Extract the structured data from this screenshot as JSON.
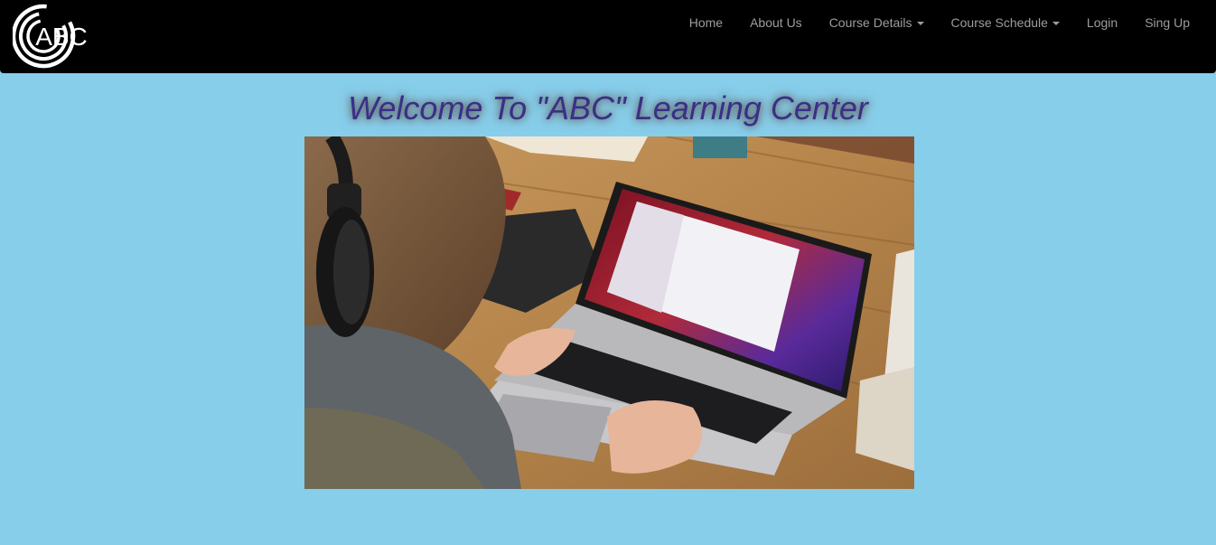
{
  "navbar": {
    "logo_text": "ABC",
    "links": [
      {
        "label": "Home",
        "dropdown": false
      },
      {
        "label": "About Us",
        "dropdown": false
      },
      {
        "label": "Course Details",
        "dropdown": true
      },
      {
        "label": "Course Schedule",
        "dropdown": true
      },
      {
        "label": "Login",
        "dropdown": false
      },
      {
        "label": "Sing Up",
        "dropdown": false
      }
    ]
  },
  "hero": {
    "title": "Welcome To \"ABC\" Learning Center"
  },
  "colors": {
    "page_background": "#87ceeb",
    "navbar_background": "#000000",
    "nav_link": "#9d9d9d",
    "title_text": "#3b2f86"
  }
}
